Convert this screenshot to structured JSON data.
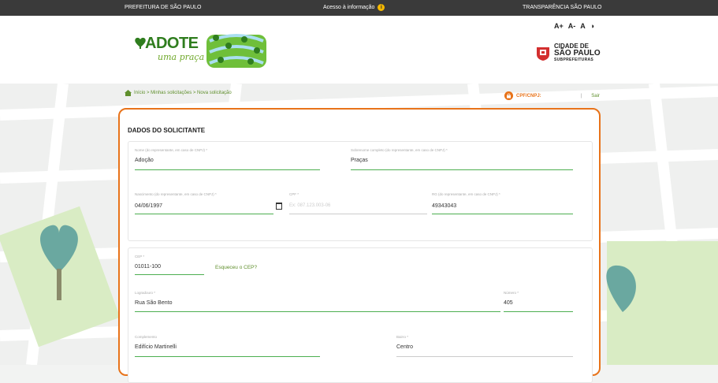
{
  "topbar": {
    "left": "PREFEITURA DE SÃO PAULO",
    "center": "Acesso à informação",
    "right": "TRANSPARÊNCIA SÃO PAULO"
  },
  "header": {
    "logo_line1": "ADOTE",
    "logo_line2": "uma praça",
    "font_controls": [
      "A+",
      "A-",
      "A",
      "◑"
    ],
    "city_line1": "CIDADE DE",
    "city_line2": "SÃO PAULO",
    "city_line3": "SUBPREFEITURAS"
  },
  "breadcrumb": "Início > Minhas solicitações > Nova solicitação",
  "account": {
    "cpf_label": "CPF/CNPJ:",
    "separator": "|",
    "logout": "Sair"
  },
  "form": {
    "title": "DADOS DO SOLICITANTE",
    "nome": {
      "label": "Nome (do representante, em caso de CNPJ) *",
      "value": "Adoção"
    },
    "sobrenome": {
      "label": "Sobrenome completo (do representante, em caso de CNPJ) *",
      "value": "Praças"
    },
    "nascimento": {
      "label": "Nascimento (do representante, em caso de CNPJ) *",
      "value": "04/06/1997"
    },
    "cpf": {
      "label": "CPF *",
      "placeholder": "Ex: 087.123.003-06"
    },
    "rg": {
      "label": "RG (do representante, em caso de CNPJ) *",
      "value": "49343043"
    },
    "cep": {
      "label": "CEP *",
      "value": "01011-100",
      "link": "Esqueceu o CEP?"
    },
    "logradouro": {
      "label": "Logradouro *",
      "value": "Rua São Bento"
    },
    "numero": {
      "label": "Número *",
      "value": "405"
    },
    "complemento": {
      "label": "Complemento",
      "value": "Edifício Martinelli"
    },
    "bairro": {
      "label": "Bairro *",
      "value": "Centro"
    }
  },
  "colors": {
    "accent": "#e8731a",
    "green": "#4caf50",
    "topbar": "#3a3a3a"
  }
}
